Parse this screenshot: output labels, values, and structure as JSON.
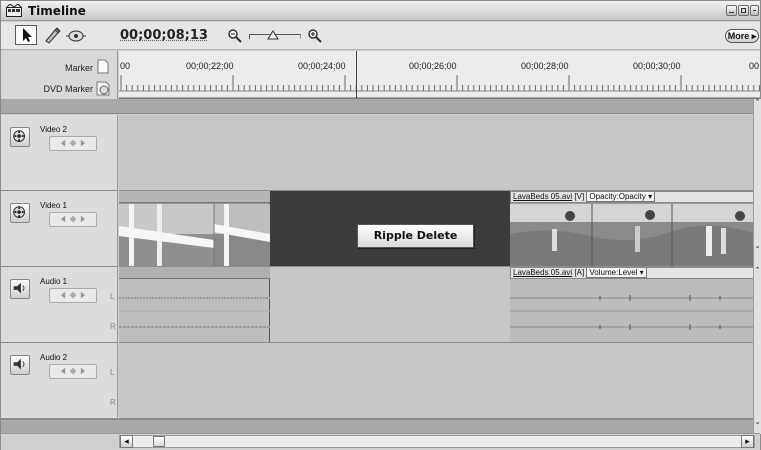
{
  "window": {
    "title": "Timeline",
    "icon": "timeline-icon"
  },
  "toolbar": {
    "timecode": "00;00;08;13",
    "more_label": "More",
    "tools": [
      "selection-tool-icon",
      "razor-tool-icon",
      "hand-tool-icon"
    ],
    "zoom_out_icon": "zoom-out-icon",
    "zoom_in_icon": "zoom-in-icon"
  },
  "ruler": {
    "marker_label": "Marker",
    "dvd_marker_label": "DVD Marker",
    "start_fragment": "00",
    "tick_labels": [
      "00;00;22;00",
      "00;00;24;00",
      "00;00;26;00",
      "00;00;28;00",
      "00;00;30;00"
    ],
    "end_fragment": "00"
  },
  "tracks": {
    "video2": {
      "name": "Video 2"
    },
    "video1": {
      "name": "Video 1"
    },
    "audio1": {
      "name": "Audio 1",
      "left": "L",
      "right": "R"
    },
    "audio2": {
      "name": "Audio 2",
      "left": "L",
      "right": "R"
    }
  },
  "clips": {
    "video_clip": {
      "name": "LavaBeds 05.avi",
      "tag": "[V]",
      "effect": "Opacity:Opacity"
    },
    "audio_clip": {
      "name": "LavaBeds 05.avi",
      "tag": "[A]",
      "effect": "Volume:Level"
    }
  },
  "context_button": {
    "label": "Ripple Delete"
  },
  "colors": {
    "gap": "#3c3c3c",
    "track_bg": "#c6c6c6",
    "header_bg": "#dcdcdc"
  }
}
